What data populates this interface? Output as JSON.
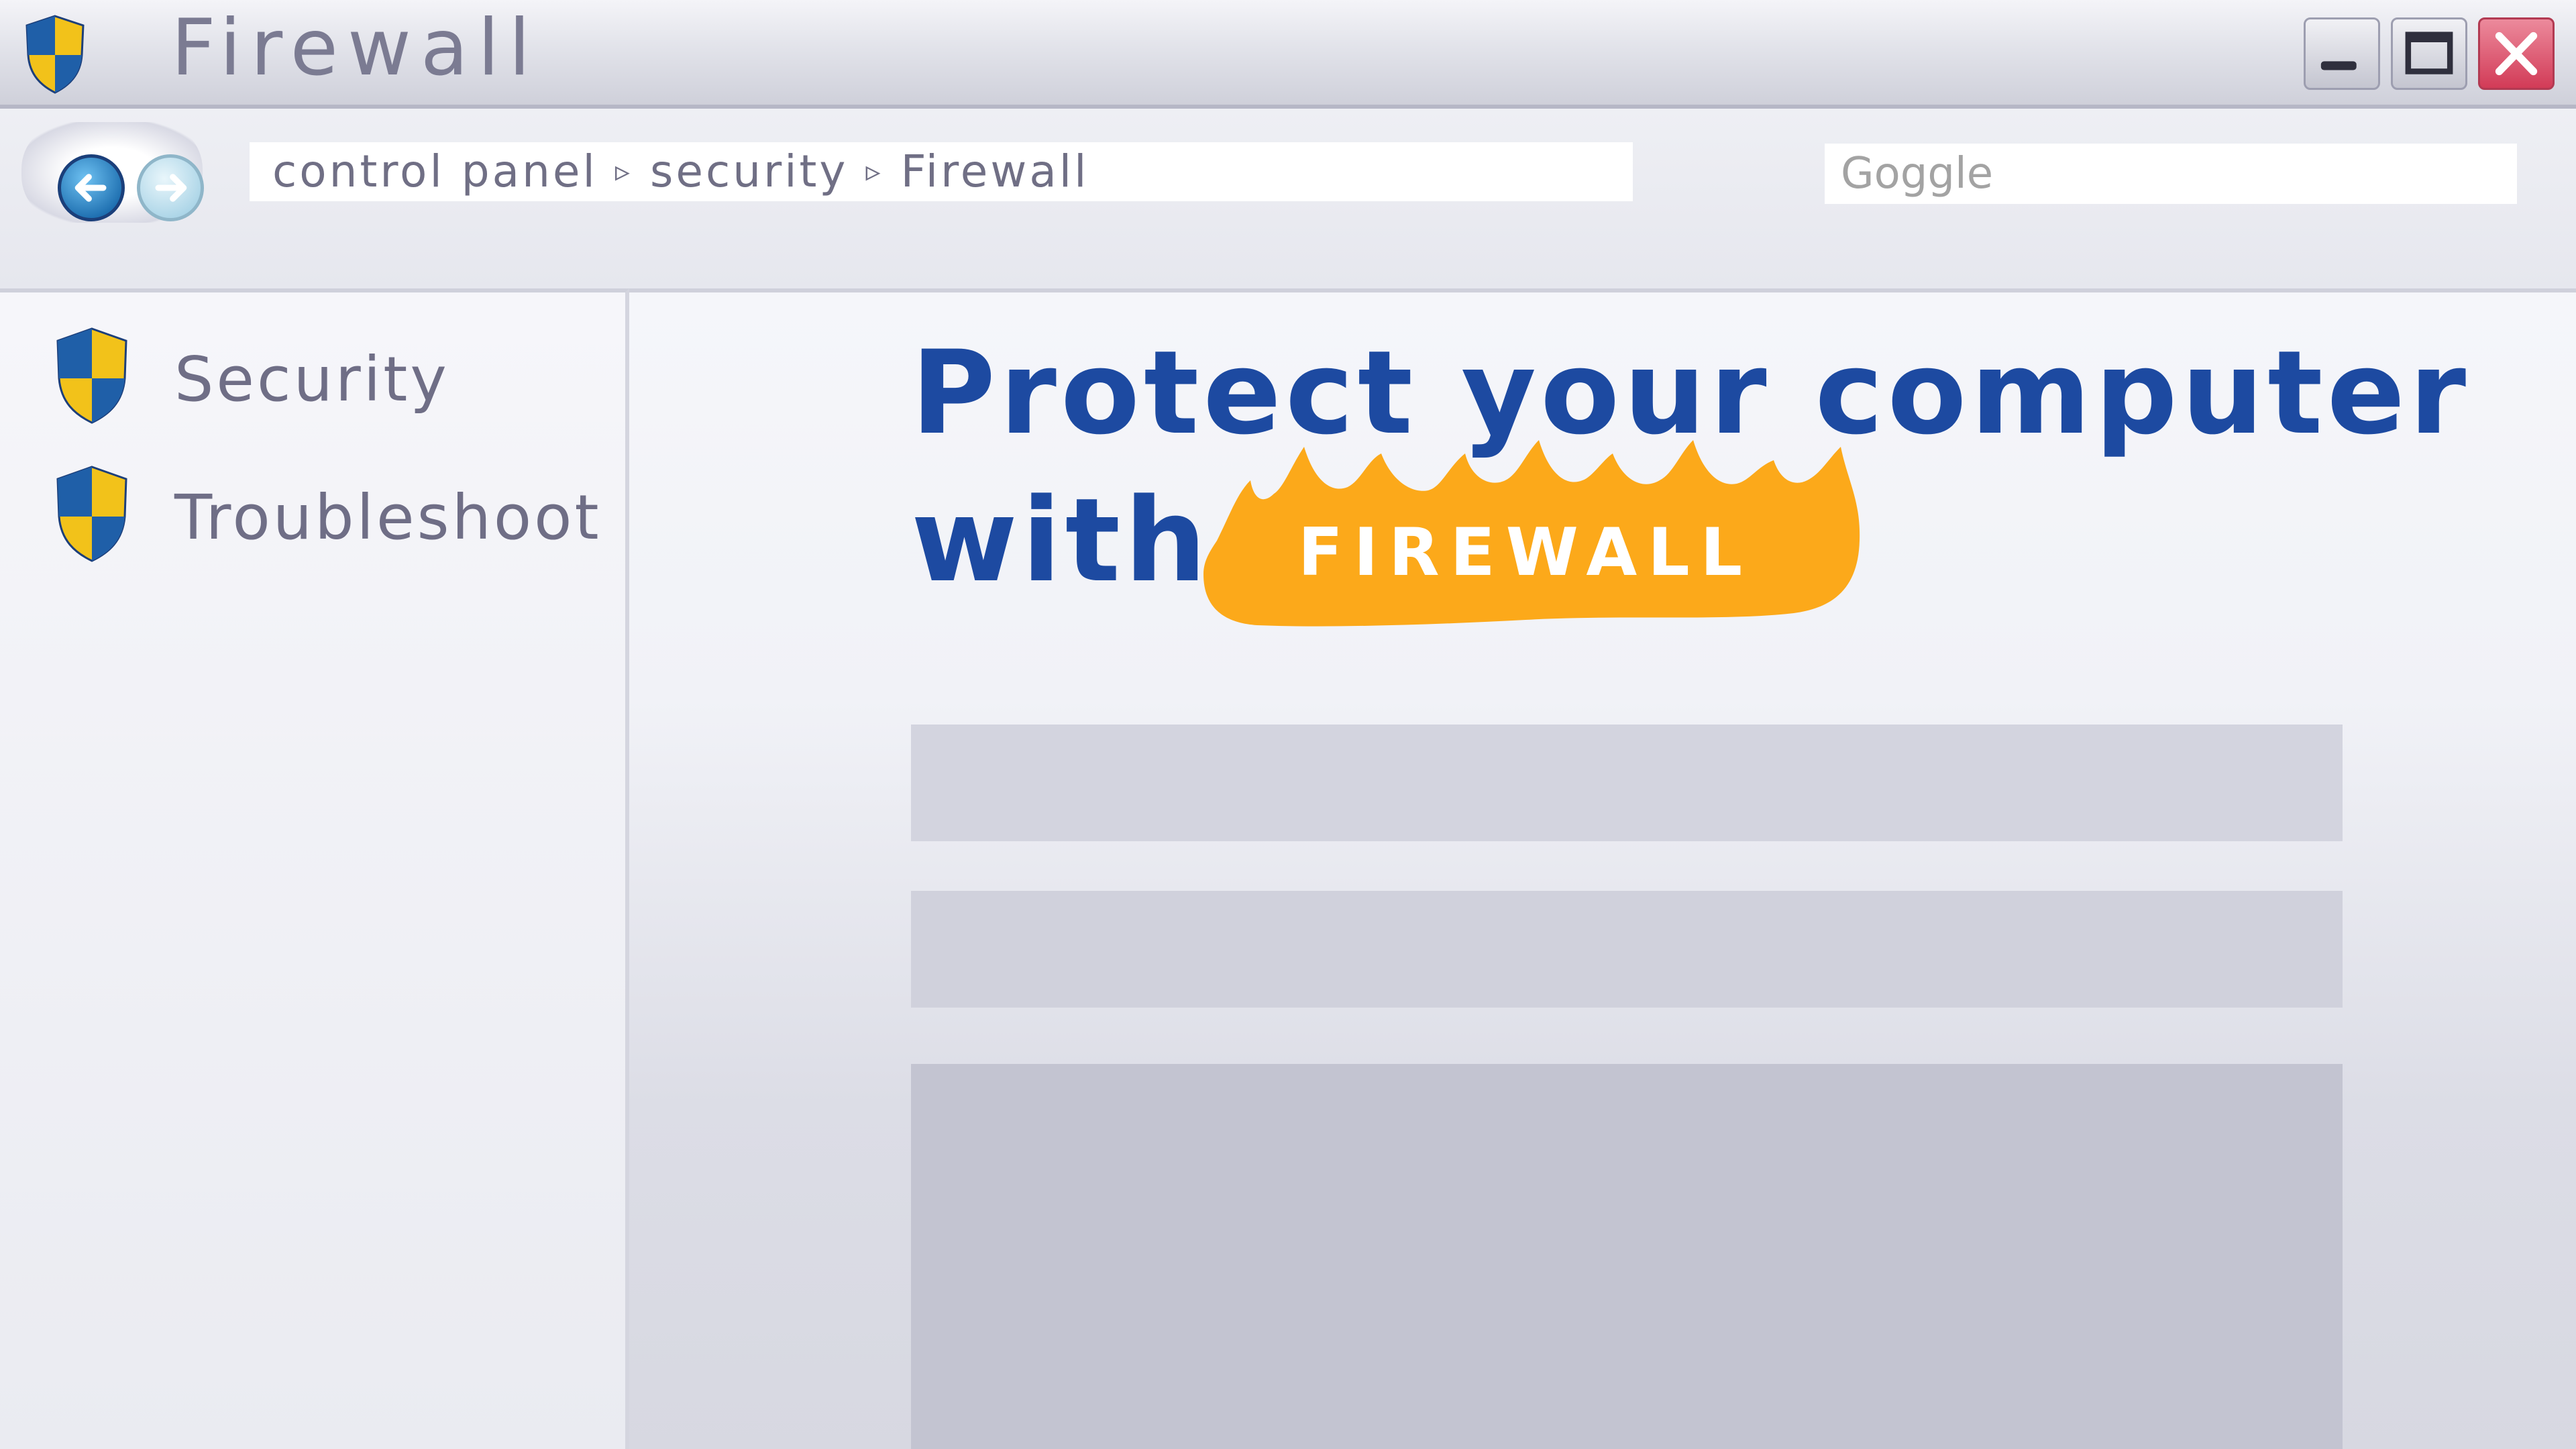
{
  "window": {
    "title": "Firewall",
    "icon": "shield-icon",
    "controls": [
      "minimize",
      "maximize",
      "close"
    ]
  },
  "nav": {
    "breadcrumb": [
      "control panel",
      "security",
      "Firewall"
    ],
    "breadcrumb_separator": "▹",
    "search_placeholder": "Goggle"
  },
  "sidebar": {
    "items": [
      {
        "label": "Security",
        "icon": "shield-icon"
      },
      {
        "label": "Troubleshoot",
        "icon": "shield-icon"
      }
    ]
  },
  "main": {
    "headline_line1": "Protect your computer",
    "headline_line2": "with",
    "badge_text": "FIREWALL"
  },
  "colors": {
    "shield_blue": "#1f5fa8",
    "shield_yellow": "#f2c21a",
    "headline": "#1d4aa1",
    "fire_orange": "#fca91a",
    "close_button": "#d23b57"
  }
}
